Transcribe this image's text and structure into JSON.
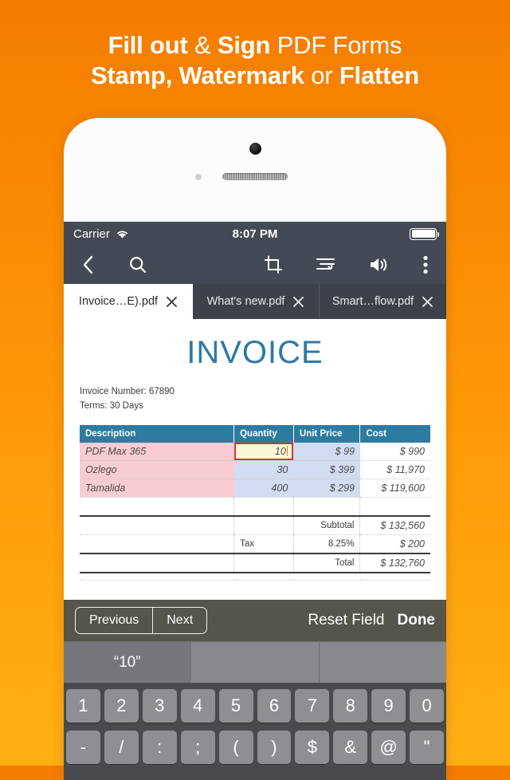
{
  "promo": {
    "line1_bold_a": "Fill out",
    "line1_amp": " & ",
    "line1_bold_b": "Sign",
    "line1_normal": " PDF Forms",
    "line2_bold_a": "Stamp, Watermark",
    "line2_normal": " or ",
    "line2_bold_b": "Flatten"
  },
  "colors": {
    "brand_orange_top": "#F47C00",
    "brand_orange_bottom": "#FFAF13",
    "chrome": "#444A55",
    "tabbar": "#3C414B",
    "invoice_blue": "#2E7BA0",
    "field_highlight_border": "#D03A2C",
    "field_highlight_bg": "#FCF6D8",
    "row_pink": "#F8CDD2",
    "row_blue": "#D2DCF1",
    "accessory_bar": "#56554B",
    "keyboard_bg": "#4A4A4E",
    "key_face": "#8E8E93"
  },
  "status_bar": {
    "carrier": "Carrier",
    "wifi_icon": "wifi-icon",
    "time": "8:07 PM",
    "battery_icon": "battery-full-icon"
  },
  "toolbar": {
    "items": [
      {
        "name": "back-icon",
        "label": "Back"
      },
      {
        "name": "search-icon",
        "label": "Search"
      },
      {
        "name": "crop-icon",
        "label": "Crop"
      },
      {
        "name": "reflow-text-icon",
        "label": "Reflow"
      },
      {
        "name": "speaker-icon",
        "label": "Read aloud"
      },
      {
        "name": "overflow-menu-icon",
        "label": "More"
      }
    ]
  },
  "tabs": [
    {
      "label": "Invoice…E).pdf",
      "active": true,
      "close_icon": "close-icon"
    },
    {
      "label": "What's new.pdf",
      "active": false,
      "close_icon": "close-icon"
    },
    {
      "label": "Smart…flow.pdf",
      "active": false,
      "close_icon": "close-icon"
    }
  ],
  "document": {
    "title": "INVOICE",
    "invoice_number_line": "Invoice Number: 67890",
    "terms_line": "Terms: 30 Days",
    "table": {
      "headers": [
        "Description",
        "Quantity",
        "Unit Price",
        "Cost"
      ],
      "rows": [
        {
          "description": "PDF Max 365",
          "quantity": "10",
          "unit_price": "$ 99",
          "cost": "$ 990",
          "active_field": true
        },
        {
          "description": "Ozlego",
          "quantity": "30",
          "unit_price": "$ 399",
          "cost": "$ 11,970",
          "active_field": false
        },
        {
          "description": "Tamalida",
          "quantity": "400",
          "unit_price": "$ 299",
          "cost": "$ 119,600",
          "active_field": false
        }
      ],
      "summary": [
        {
          "left": "",
          "label": "Subtotal",
          "value": "$ 132,560"
        },
        {
          "left": "Tax",
          "label": "8.25%",
          "value": "$ 200"
        },
        {
          "left": "",
          "label": "Total",
          "value": "$ 132,760"
        }
      ]
    }
  },
  "form_accessory": {
    "previous_label": "Previous",
    "next_label": "Next",
    "reset_label": "Reset Field",
    "done_label": "Done"
  },
  "predictive_bar": {
    "suggestions": [
      "“10”",
      "",
      ""
    ]
  },
  "keyboard": {
    "row1": [
      "1",
      "2",
      "3",
      "4",
      "5",
      "6",
      "7",
      "8",
      "9",
      "0"
    ],
    "row2": [
      "-",
      "/",
      ":",
      ";",
      "(",
      ")",
      "$",
      "&",
      "@",
      "\""
    ]
  }
}
